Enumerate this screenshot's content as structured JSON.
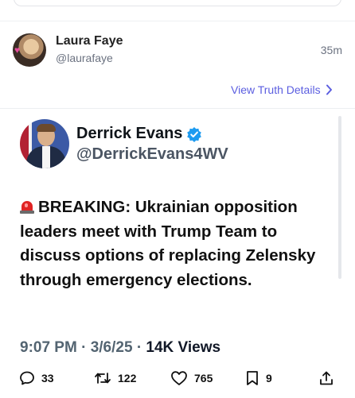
{
  "post": {
    "author_name": "Laura Faye",
    "author_handle": "@laurafaye",
    "time": "35m",
    "view_details": "View Truth Details"
  },
  "tweet": {
    "name": "Derrick Evans",
    "handle": "@DerrickEvans4WV",
    "text": "BREAKING: Ukrainian opposition leaders meet with Trump Team to discuss options of replacing Zelensky through emergency elections.",
    "time": "9:07 PM",
    "date": "3/6/25",
    "views": "14K Views",
    "separator": "·"
  },
  "actions": {
    "replies": "33",
    "retweets": "122",
    "likes": "765",
    "bookmarks": "9"
  },
  "colors": {
    "link": "#5b5ee0",
    "verified": "#1d9bf0"
  },
  "icons": [
    "siren-icon",
    "verified-icon",
    "chevron-right-icon",
    "reply-icon",
    "retweet-icon",
    "like-icon",
    "bookmark-icon",
    "share-icon"
  ]
}
